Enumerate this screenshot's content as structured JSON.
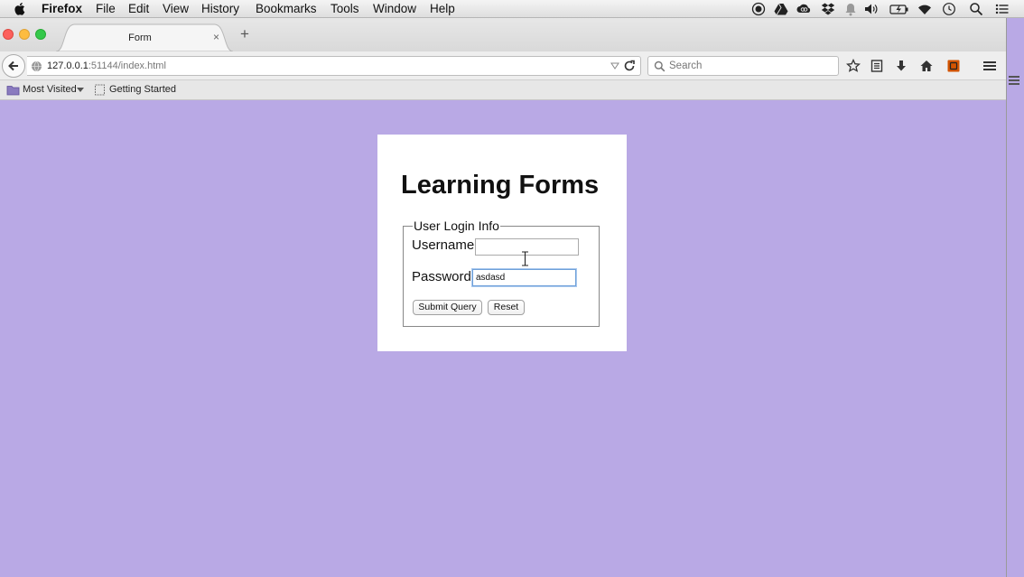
{
  "menubar": {
    "app_name": "Firefox",
    "items": [
      "File",
      "Edit",
      "View",
      "History",
      "Bookmarks",
      "Tools",
      "Window",
      "Help"
    ],
    "status_icons": [
      "record-icon",
      "drive-icon",
      "creative-cloud-icon",
      "dropbox-icon",
      "notification-icon",
      "volume-icon",
      "battery-icon",
      "wifi-icon",
      "time-machine-icon",
      "spotlight-icon",
      "notification-center-icon"
    ]
  },
  "browser": {
    "tab": {
      "title": "Form",
      "close": "×"
    },
    "new_tab": "+",
    "url": {
      "host": "127.0.0.1",
      "path": ":51144/index.html"
    },
    "search_placeholder": "Search",
    "toolbar_icons": [
      "bookmark-star-icon",
      "reading-list-icon",
      "download-icon",
      "home-icon",
      "extension-icon",
      "menu-icon"
    ]
  },
  "bookmarks": {
    "items": [
      {
        "label": "Most Visited",
        "icon": "folder-icon"
      },
      {
        "label": "Getting Started",
        "icon": "page-icon"
      }
    ]
  },
  "page": {
    "title": "Learning Forms",
    "legend": "User Login Info",
    "username": {
      "label": "Username",
      "value": ""
    },
    "password": {
      "label": "Password",
      "value": "asdasd"
    },
    "submit_label": "Submit Query",
    "reset_label": "Reset",
    "background_color": "#b9a9e5"
  }
}
